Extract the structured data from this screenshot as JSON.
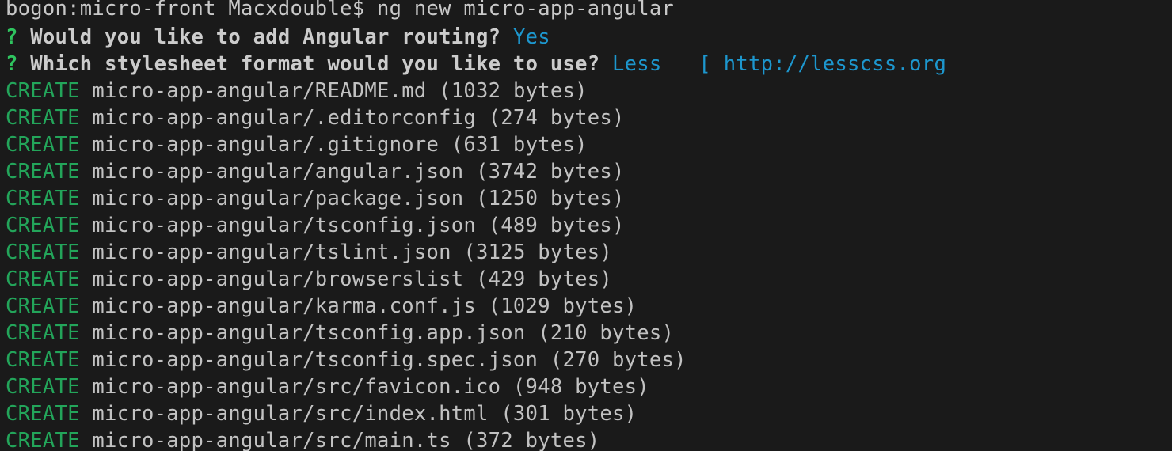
{
  "terminal": {
    "window_title": "bogon:micro-front Macxdouble$ — ng new micro-app-angular",
    "background_color": "#1a1a1a",
    "colors": {
      "default_text": "#c8c8c8",
      "prompt_marker": "#2fc45f",
      "question_text": "#cccccc",
      "answer": "#1d97ce",
      "hint_link": "#1d97ce",
      "create_keyword": "#23a55a",
      "file_path": "#c2c2c2"
    },
    "command_line": {
      "host": "bogon",
      "cwd": "micro-front",
      "user": "Macxdouble",
      "prompt_symbol": "$",
      "prefix": "bogon:micro-front Macxdouble$ ",
      "command": "ng new micro-app-angular"
    },
    "prompts": [
      {
        "marker": "?",
        "question": " Would you like to add Angular routing? ",
        "answer": "Yes",
        "hint": ""
      },
      {
        "marker": "?",
        "question": " Which stylesheet format would you like to use? ",
        "answer": "Less",
        "hint": "   [ http://lesscss.org"
      }
    ],
    "create_keyword": "CREATE",
    "created_files": [
      {
        "path": " micro-app-angular/README.md",
        "size": " (1032 bytes)"
      },
      {
        "path": " micro-app-angular/.editorconfig",
        "size": " (274 bytes)"
      },
      {
        "path": " micro-app-angular/.gitignore",
        "size": " (631 bytes)"
      },
      {
        "path": " micro-app-angular/angular.json",
        "size": " (3742 bytes)"
      },
      {
        "path": " micro-app-angular/package.json",
        "size": " (1250 bytes)"
      },
      {
        "path": " micro-app-angular/tsconfig.json",
        "size": " (489 bytes)"
      },
      {
        "path": " micro-app-angular/tslint.json",
        "size": " (3125 bytes)"
      },
      {
        "path": " micro-app-angular/browserslist",
        "size": " (429 bytes)"
      },
      {
        "path": " micro-app-angular/karma.conf.js",
        "size": " (1029 bytes)"
      },
      {
        "path": " micro-app-angular/tsconfig.app.json",
        "size": " (210 bytes)"
      },
      {
        "path": " micro-app-angular/tsconfig.spec.json",
        "size": " (270 bytes)"
      },
      {
        "path": " micro-app-angular/src/favicon.ico",
        "size": " (948 bytes)"
      },
      {
        "path": " micro-app-angular/src/index.html",
        "size": " (301 bytes)"
      },
      {
        "path": " micro-app-angular/src/main.ts",
        "size": " (372 bytes)"
      }
    ]
  }
}
